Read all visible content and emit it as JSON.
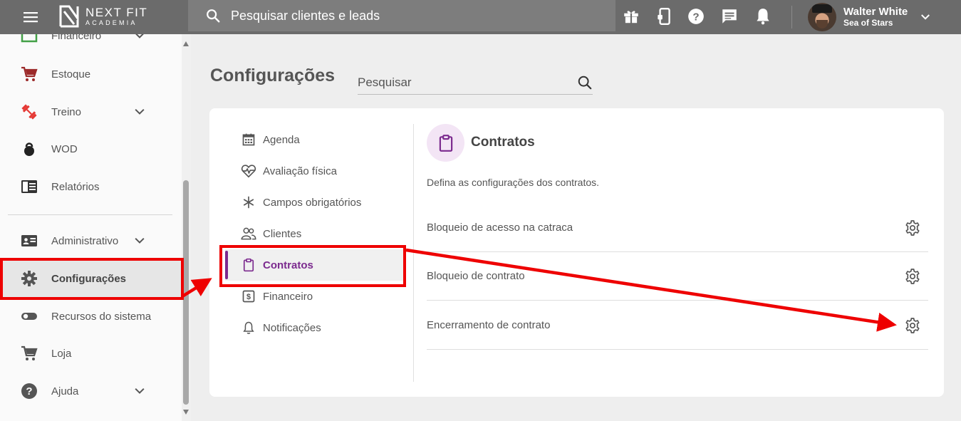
{
  "topbar": {
    "brand_line1": "NEXT FIT",
    "brand_line2": "ACADEMIA",
    "search_placeholder": "Pesquisar clientes e leads",
    "icons": [
      "gift-icon",
      "mobile-icon",
      "help-icon",
      "chat-icon",
      "bell-icon"
    ],
    "user_name": "Walter White",
    "user_unit": "Sea of Stars"
  },
  "sidebar": {
    "partial_item": "Financeiro",
    "items": [
      {
        "label": "Estoque",
        "icon": "cart-icon"
      },
      {
        "label": "Treino",
        "icon": "dumbbell-icon",
        "expandable": true
      },
      {
        "label": "WOD",
        "icon": "kettlebell-icon"
      },
      {
        "label": "Relatórios",
        "icon": "report-icon"
      },
      {
        "label": "Administrativo",
        "icon": "id-card-icon",
        "expandable": true
      },
      {
        "label": "Configurações",
        "icon": "gear-icon",
        "active": true
      },
      {
        "label": "Recursos do sistema",
        "icon": "toggle-icon"
      },
      {
        "label": "Loja",
        "icon": "cart-icon"
      },
      {
        "label": "Ajuda",
        "icon": "help-icon",
        "expandable": true
      }
    ]
  },
  "main": {
    "title": "Configurações",
    "search_placeholder": "Pesquisar",
    "config_nav": [
      {
        "label": "Agenda",
        "icon": "calendar-icon"
      },
      {
        "label": "Avaliação física",
        "icon": "heart-pulse-icon"
      },
      {
        "label": "Campos obrigatórios",
        "icon": "asterisk-icon"
      },
      {
        "label": "Clientes",
        "icon": "people-icon"
      },
      {
        "label": "Contratos",
        "icon": "clipboard-icon",
        "active": true
      },
      {
        "label": "Financeiro",
        "icon": "dollar-icon"
      },
      {
        "label": "Notificações",
        "icon": "bell-outline-icon"
      }
    ],
    "section": {
      "title": "Contratos",
      "description": "Defina as configurações dos contratos.",
      "options": [
        {
          "label": "Bloqueio de acesso na catraca"
        },
        {
          "label": "Bloqueio de contrato"
        },
        {
          "label": "Encerramento de contrato"
        }
      ]
    }
  },
  "colors": {
    "topbar": "#6b6b6b",
    "accent": "#7b2a8e",
    "annotation": "#ee0000"
  }
}
